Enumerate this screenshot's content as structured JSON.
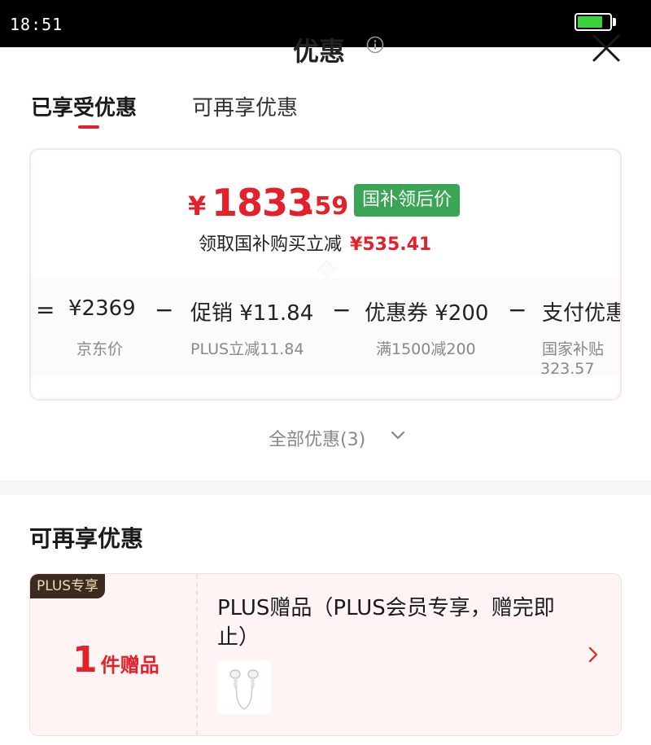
{
  "status_bar": {
    "time": "18:51",
    "battery_level": 0.8,
    "battery_color": "#3dd13d"
  },
  "header": {
    "title": "优惠",
    "info_icon": "info-icon",
    "close_icon": "close-icon"
  },
  "tabs": [
    {
      "label": "已享受优惠",
      "active": true
    },
    {
      "label": "可再享优惠",
      "active": false
    }
  ],
  "price_summary": {
    "currency": "¥",
    "price_integer": "1833",
    "price_decimal": ".59",
    "badge": "国补领后价",
    "subsidy_text": "领取国补购买立减",
    "subsidy_amount": "¥535.41"
  },
  "breakdown": {
    "equals": "=",
    "items": [
      {
        "main": "¥2369",
        "sub": "京东价"
      },
      {
        "operator": "−",
        "main": "促销 ¥11.84",
        "sub": "PLUS立减11.84"
      },
      {
        "operator": "−",
        "main": "优惠券 ¥200",
        "sub": "满1500减200"
      },
      {
        "operator": "−",
        "main": "支付优惠",
        "sub": "国家补贴",
        "sub2": "323.57"
      }
    ]
  },
  "all_offers_link": "全部优惠(3)",
  "more_offers": {
    "section_title": "可再享优惠",
    "gift_card": {
      "tag": "PLUS专享",
      "count": "1",
      "count_unit": "件赠品",
      "title": "PLUS赠品（PLUS会员专享，赠完即止）",
      "thumbnail": "earphones-thumbnail"
    }
  },
  "colors": {
    "accent_red": "#e4202a",
    "badge_green": "#3aa655",
    "plus_dark": "#3b2a20",
    "plus_gold": "#f3d9b0"
  }
}
